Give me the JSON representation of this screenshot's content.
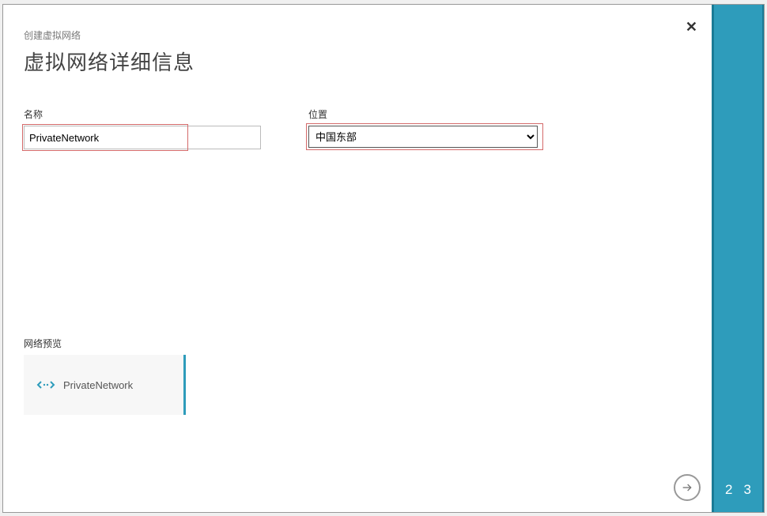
{
  "breadcrumb": "创建虚拟网络",
  "page_title": "虚拟网络详细信息",
  "form": {
    "name_label": "名称",
    "name_value": "PrivateNetwork",
    "location_label": "位置",
    "location_value": "中国东部"
  },
  "preview": {
    "label": "网络预览",
    "name": "PrivateNetwork"
  },
  "steps": {
    "step2": "2",
    "step3": "3"
  },
  "icons": {
    "close": "✕"
  }
}
